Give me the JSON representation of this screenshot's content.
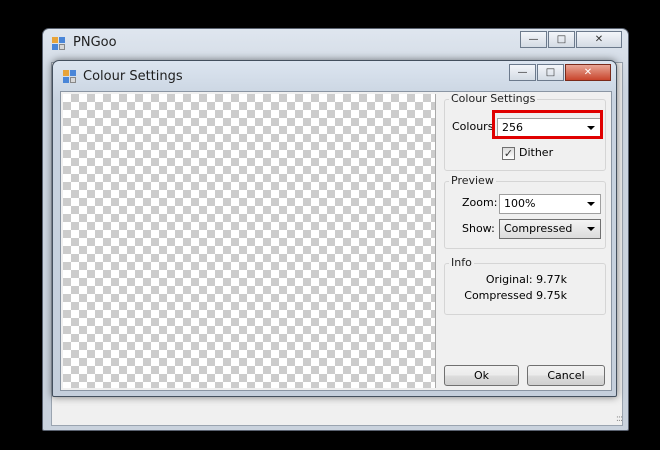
{
  "outer_window": {
    "title": "PNGoo",
    "minimize": "▭",
    "maximize": "□",
    "close": "✕"
  },
  "dialog": {
    "title": "Colour Settings",
    "minimize": "▭",
    "maximize": "□",
    "close": "✕"
  },
  "colour_settings": {
    "group_title": "Colour Settings",
    "colours_label": "Colours",
    "colours_value": "256",
    "dither_label": "Dither",
    "dither_checked": true,
    "check_mark": "✓"
  },
  "preview": {
    "group_title": "Preview",
    "zoom_label": "Zoom:",
    "zoom_value": "100%",
    "show_label": "Show:",
    "show_value": "Compressed"
  },
  "info": {
    "group_title": "Info",
    "original": "Original: 9.77k",
    "compressed": "Compressed 9.75k"
  },
  "buttons": {
    "ok": "Ok",
    "cancel": "Cancel"
  },
  "grip": ":::",
  "colors": {
    "highlight": "#e00000",
    "close_button": "#c9452c"
  }
}
